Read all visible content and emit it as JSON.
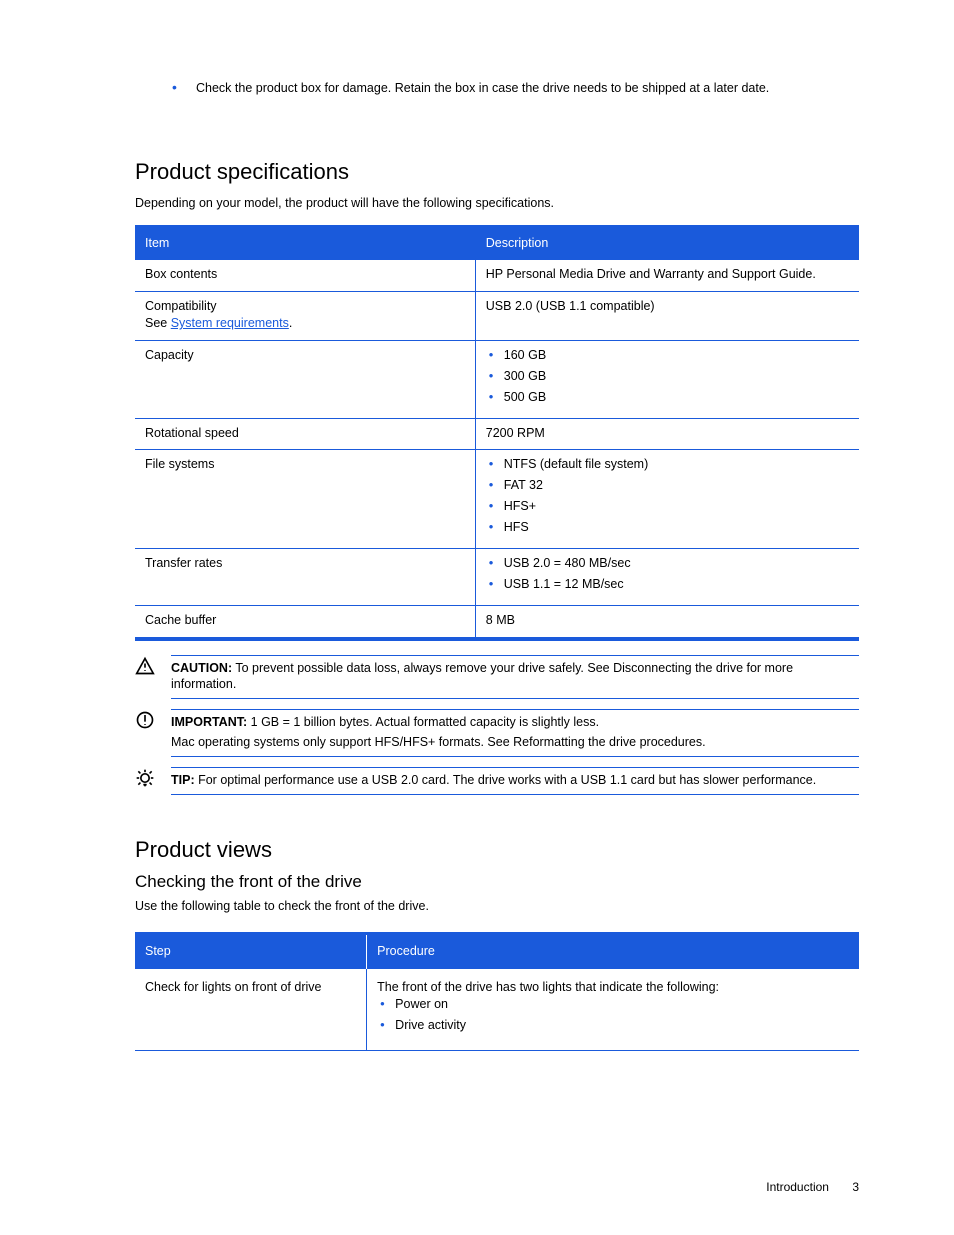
{
  "top_bullet": "Check the product box for damage. Retain the box in case the drive needs to be shipped at a later date.",
  "specs_section": {
    "heading": "Product specifications",
    "lead": "Depending on your model, the product will have the following specifications.",
    "headers": {
      "item": "Item",
      "desc": "Description"
    },
    "rows": [
      {
        "item": {
          "text": "Box contents"
        },
        "desc": "HP Personal Media Drive and Warranty and Support Guide."
      },
      {
        "item": {
          "text": "Compatibility",
          "extra_html": "See <a class=\"link\" data-name=\"system-requirements-link\" data-interactable=\"true\">System requirements</a>."
        },
        "desc": "USB 2.0 (USB 1.1 compatible)"
      },
      {
        "item": {
          "text": "Capacity"
        },
        "desc_list": [
          "160 GB",
          "300 GB",
          "500 GB"
        ]
      },
      {
        "item": {
          "text": "Rotational speed"
        },
        "desc": "7200 RPM"
      },
      {
        "item": {
          "text": "File systems"
        },
        "desc_list": [
          "NTFS (default file system)",
          "FAT 32",
          "HFS+",
          "HFS"
        ]
      },
      {
        "item": {
          "text": "Transfer rates"
        },
        "desc_list": [
          "USB 2.0 = 480 MB/sec",
          "USB 1.1 = 12 MB/sec"
        ]
      },
      {
        "item": {
          "text": "Cache buffer"
        },
        "desc": "8 MB"
      }
    ]
  },
  "admonitions": [
    {
      "kind": "caution",
      "label": "CAUTION:",
      "text": "To prevent possible data loss, always remove your drive safely. See Disconnecting the drive for more information."
    },
    {
      "kind": "important",
      "label": "IMPORTANT:",
      "text": "1 GB = 1 billion bytes. Actual formatted capacity is slightly less.",
      "text2": "Mac operating systems only support HFS/HFS+ formats. See Reformatting the drive procedures."
    },
    {
      "kind": "tip",
      "label": "TIP:",
      "text": "For optimal performance use a USB 2.0 card. The drive works with a USB 1.1 card but has slower performance."
    }
  ],
  "views": {
    "heading": "Product views",
    "sub": "Checking the front of the drive",
    "lead": "Use the following table to check the front of the drive.",
    "headers": {
      "step": "Step",
      "proc": "Procedure"
    },
    "row": {
      "step": "Check for lights on front of drive",
      "proc_intro": "The front of the drive has two lights that indicate the following:",
      "proc_list": [
        "Power on",
        "Drive activity"
      ]
    }
  },
  "footer": {
    "section": "Introduction",
    "page": "3"
  }
}
